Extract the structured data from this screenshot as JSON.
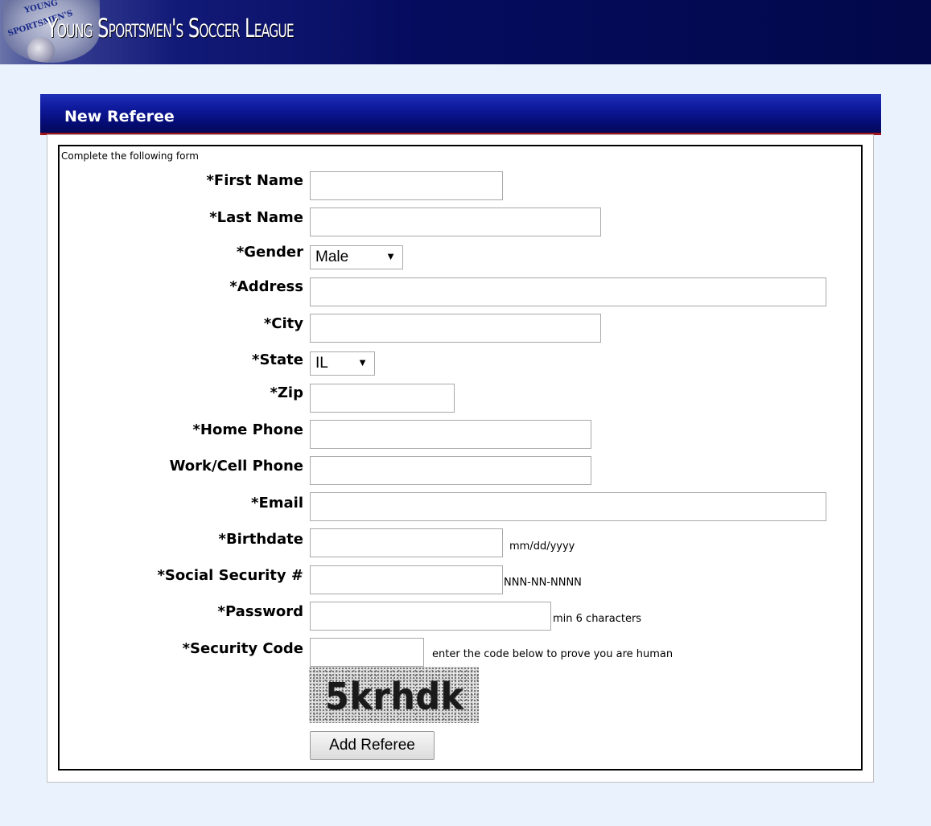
{
  "banner": {
    "logo_text_top": "YOUNG",
    "logo_text_mid": "SPORTSMEN'S",
    "site_title": "Young Sportsmen's Soccer League"
  },
  "panel": {
    "title": "New Referee",
    "intro": "Complete the following form"
  },
  "form": {
    "first_name": {
      "label": "*First Name",
      "value": ""
    },
    "last_name": {
      "label": "*Last Name",
      "value": ""
    },
    "gender": {
      "label": "*Gender",
      "value": "Male"
    },
    "address": {
      "label": "*Address",
      "value": ""
    },
    "city": {
      "label": "*City",
      "value": ""
    },
    "state": {
      "label": "*State",
      "value": "IL"
    },
    "zip": {
      "label": "*Zip",
      "value": ""
    },
    "home_phone": {
      "label": "*Home Phone",
      "value": ""
    },
    "work_cell_phone": {
      "label": "Work/Cell Phone",
      "value": ""
    },
    "email": {
      "label": "*Email",
      "value": ""
    },
    "birthdate": {
      "label": "*Birthdate",
      "value": "",
      "hint": "mm/dd/yyyy"
    },
    "ssn": {
      "label": "*Social Security #",
      "value": "",
      "hint": "NNN-NN-NNNN"
    },
    "password": {
      "label": "*Password",
      "value": "",
      "hint": "min 6 characters"
    },
    "security_code": {
      "label": "*Security Code",
      "value": "",
      "hint": "enter the code below to prove you are human"
    },
    "captcha_text": "5krhdk",
    "submit_label": "Add Referee"
  },
  "icons": {
    "dropdown_arrow": "▼"
  }
}
